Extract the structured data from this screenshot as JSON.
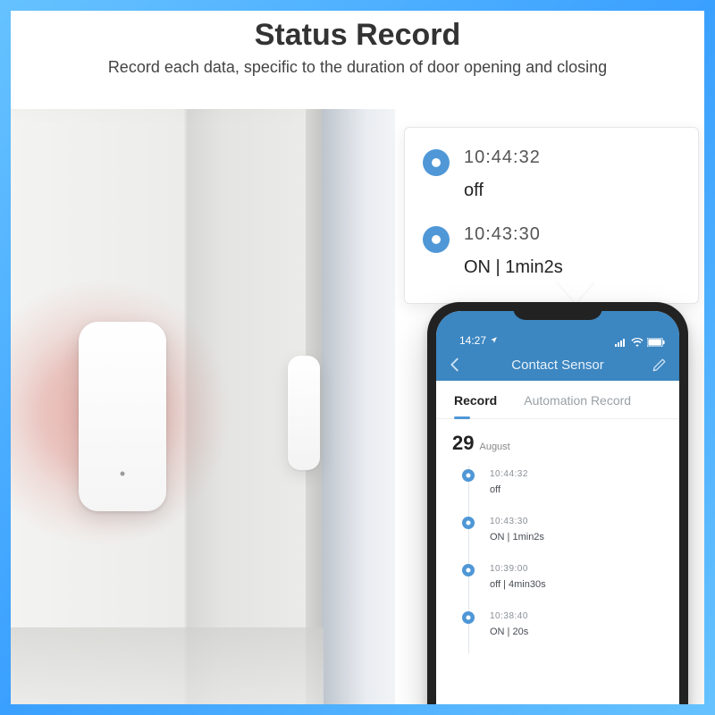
{
  "header": {
    "title": "Status Record",
    "subtitle": "Record each data, specific to the duration of door opening and closing"
  },
  "callout": {
    "items": [
      {
        "time": "10:44:32",
        "status": "off"
      },
      {
        "time": "10:43:30",
        "status": "ON  | 1min2s"
      }
    ]
  },
  "phone": {
    "statusbar": {
      "time": "14:27"
    },
    "navbar": {
      "title": "Contact Sensor"
    },
    "tabs": {
      "record": "Record",
      "automation": "Automation Record"
    },
    "date": {
      "day": "29",
      "month": "August"
    },
    "timeline": [
      {
        "time": "10:44:32",
        "status": "off"
      },
      {
        "time": "10:43:30",
        "status": "ON  | 1min2s"
      },
      {
        "time": "10:39:00",
        "status": "off  | 4min30s"
      },
      {
        "time": "10:38:40",
        "status": "ON  | 20s"
      }
    ]
  },
  "icons": {
    "sensor_body": "door-sensor-body",
    "sensor_mag": "door-sensor-magnet"
  }
}
